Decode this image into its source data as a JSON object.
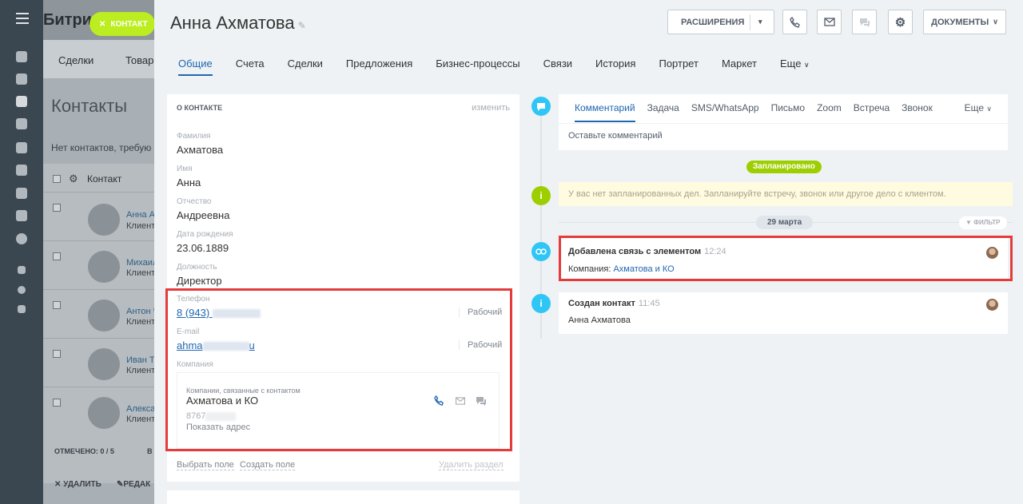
{
  "background": {
    "logo": "Битри",
    "chip_label": "КОНТАКТ",
    "tabs": [
      "Сделки",
      "Товар"
    ],
    "page_title": "Контакты",
    "note": "Нет контактов, требую",
    "grid_header": "Контакт",
    "rows": [
      {
        "name": "Анна А",
        "sub": "Клиент"
      },
      {
        "name": "Михаил",
        "sub": "Клиент"
      },
      {
        "name": "Антон Ч",
        "sub": "Клиент"
      },
      {
        "name": "Иван Т",
        "sub": "Клиент"
      },
      {
        "name": "Алекса",
        "sub": "Клиент"
      }
    ],
    "marked": "ОТМЕЧЕНО: 0 / 5",
    "marked_extra": "В",
    "delete": "УДАЛИТЬ",
    "edit": "РЕДАК"
  },
  "header": {
    "title": "Анна  Ахматова",
    "extensions": "РАСШИРЕНИЯ",
    "documents": "ДОКУМЕНТЫ"
  },
  "tabs": [
    "Общие",
    "Счета",
    "Сделки",
    "Предложения",
    "Бизнес-процессы",
    "Связи",
    "История",
    "Портрет",
    "Маркет",
    "Еще"
  ],
  "about": {
    "heading": "О КОНТАКТЕ",
    "edit": "изменить",
    "fields": [
      {
        "label": "Фамилия",
        "value": "Ахматова"
      },
      {
        "label": "Имя",
        "value": "Анна"
      },
      {
        "label": "Отчество",
        "value": "Андреевна"
      },
      {
        "label": "Дата рождения",
        "value": "23.06.1889"
      },
      {
        "label": "Должность",
        "value": "Директор"
      }
    ],
    "phone_label": "Телефон",
    "phone_value": "8 (943)",
    "phone_type": "Рабочий",
    "email_label": "E-mail",
    "email_value": "ahma",
    "email_value_tail": "u",
    "email_type": "Рабочий",
    "company_label": "Компания",
    "company_box_label": "Компании, связанные с контактом",
    "company_name": "Ахматова и КО",
    "company_phone": "8767",
    "show_address": "Показать адрес",
    "select_field": "Выбрать поле",
    "create_field": "Создать поле",
    "delete_section": "Удалить раздел"
  },
  "editor": {
    "tabs": [
      "Комментарий",
      "Задача",
      "SMS/WhatsApp",
      "Письмо",
      "Zoom",
      "Встреча",
      "Звонок"
    ],
    "more": "Еще",
    "placeholder": "Оставьте комментарий"
  },
  "timeline": {
    "planned": "Запланировано",
    "no_deals": "У вас нет запланированных дел. Запланируйте встречу, звонок или другое дело с клиентом.",
    "date": "29 марта",
    "filter": "ФИЛЬТР",
    "items": [
      {
        "title": "Добавлена связь с элементом",
        "time": "12:24",
        "body_prefix": "Компания:",
        "body_link": "Ахматова и КО"
      },
      {
        "title": "Создан контакт",
        "time": "11:45",
        "body": "Анна Ахматова"
      }
    ]
  },
  "colors": {
    "accent": "#2067b0",
    "planned": "#9dcf00",
    "highlight": "#e63b3b",
    "chip": "#bbed21"
  }
}
